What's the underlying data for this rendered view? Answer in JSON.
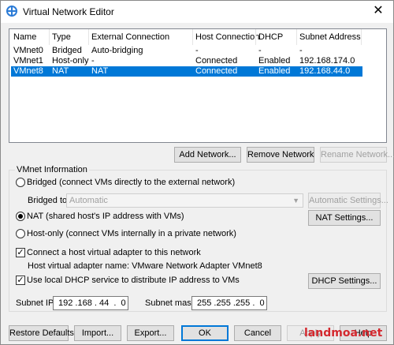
{
  "window": {
    "title": "Virtual Network Editor"
  },
  "table": {
    "columns": [
      "Name",
      "Type",
      "External Connection",
      "Host Connection",
      "DHCP",
      "Subnet Address"
    ],
    "rows": [
      [
        "VMnet0",
        "Bridged",
        "Auto-bridging",
        "-",
        "-",
        "-"
      ],
      [
        "VMnet1",
        "Host-only",
        "-",
        "Connected",
        "Enabled",
        "192.168.174.0"
      ],
      [
        "VMnet8",
        "NAT",
        "NAT",
        "Connected",
        "Enabled",
        "192.168.44.0"
      ]
    ],
    "selected_index": 2
  },
  "list_buttons": {
    "add": "Add Network...",
    "remove": "Remove Network",
    "rename": "Rename Network..."
  },
  "vmnet_info": {
    "title": "VMnet Information",
    "bridged_label": "Bridged (connect VMs directly to the external network)",
    "bridged_to_label": "Bridged to:",
    "bridged_to_value": "Automatic",
    "auto_settings": "Automatic Settings...",
    "nat_label": "NAT (shared host's IP address with VMs)",
    "nat_settings": "NAT Settings...",
    "hostonly_label": "Host-only (connect VMs internally in a private network)",
    "connect_adapter_label": "Connect a host virtual adapter to this network",
    "adapter_name": "Host virtual adapter name: VMware Network Adapter VMnet8",
    "dhcp_label": "Use local DHCP service to distribute IP address to VMs",
    "dhcp_settings": "DHCP Settings...",
    "subnet_ip_label": "Subnet IP:",
    "subnet_ip": "192 .168 . 44  .  0",
    "subnet_mask_label": "Subnet mask:",
    "subnet_mask": "255 .255 .255 .  0",
    "selected_mode": "nat",
    "connect_adapter_checked": true,
    "dhcp_checked": true
  },
  "footer": {
    "restore": "Restore Defaults",
    "import": "Import...",
    "export": "Export...",
    "ok": "OK",
    "cancel": "Cancel",
    "apply": "Apply",
    "help": "Help"
  },
  "watermark": "landmoa.net",
  "colors": {
    "selection": "#0078d7",
    "watermark": "#d4282e"
  }
}
